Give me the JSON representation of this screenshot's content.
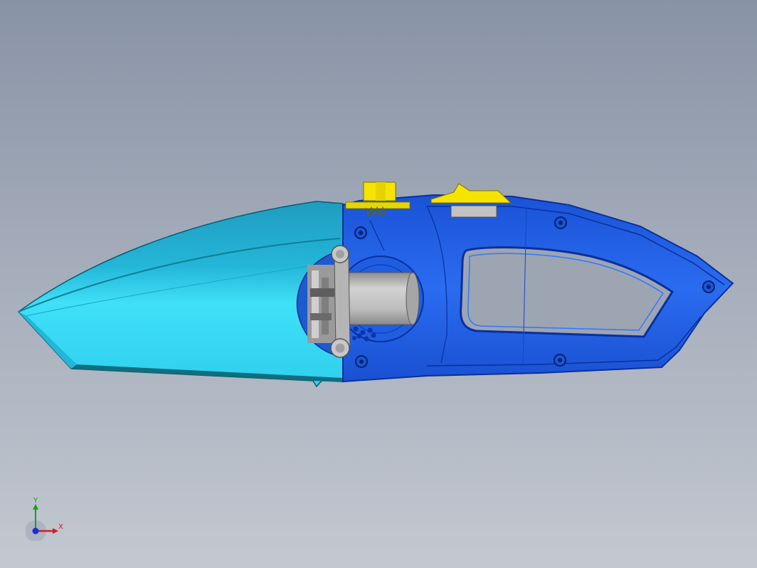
{
  "triad": {
    "y_label": "Y",
    "x_label": "X"
  },
  "colors": {
    "background_top": "#8893a5",
    "background_bottom": "#c3c8d0",
    "nozzle_cyan": "#33cfee",
    "nozzle_shadow": "#0f7f96",
    "handle_blue": "#1f63e6",
    "handle_dark": "#0a2f9c",
    "motor_gray": "#b3b3b3",
    "trigger_yellow": "#f5e400",
    "axis_x_red": "#d02020",
    "axis_y_green": "#1f9b1f",
    "origin_blue": "#1a2fd8"
  }
}
